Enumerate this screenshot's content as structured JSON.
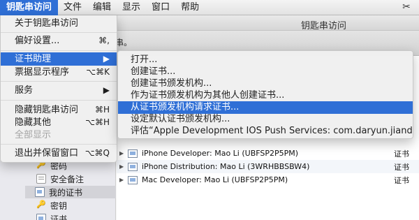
{
  "menubar": {
    "app": "钥匙串访问",
    "items": [
      "文件",
      "编辑",
      "显示",
      "窗口",
      "帮助"
    ],
    "tool_icon": "scissors-icon"
  },
  "window": {
    "title": "钥匙串访问",
    "partial_text": "串。"
  },
  "sidebar": {
    "items": [
      {
        "label": "密码",
        "icon": "key-icon"
      },
      {
        "label": "安全备注",
        "icon": "note-icon"
      },
      {
        "label": "我的证书",
        "icon": "certificate-icon"
      },
      {
        "label": "密钥",
        "icon": "key-icon"
      },
      {
        "label": "证书",
        "icon": "certificate-icon"
      }
    ]
  },
  "certlist": {
    "rows": [
      {
        "name": "iPhone Developer: Mao Li (UBFSP2P5PM)",
        "type": "证书"
      },
      {
        "name": "iPhone Distribution: Mao Li (3WRHBBSBW4)",
        "type": "证书"
      },
      {
        "name": "Mac Developer: Mao Li (UBFSP2P5PM)",
        "type": "证书"
      }
    ]
  },
  "app_menu": {
    "about": "关于钥匙串访问",
    "prefs": "偏好设置...",
    "prefs_shortcut": "⌘,",
    "cert_assistant": "证书助理",
    "ticket_viewer": "票据显示程序",
    "ticket_viewer_shortcut": "⌥⌘K",
    "services": "服务",
    "hide": "隐藏钥匙串访问",
    "hide_shortcut": "⌘H",
    "hide_others": "隐藏其他",
    "hide_others_shortcut": "⌥⌘H",
    "show_all": "全部显示",
    "quit": "退出并保留窗口",
    "quit_shortcut": "⌥⌘Q"
  },
  "submenu": {
    "items": [
      "打开...",
      "创建证书...",
      "创建证书颁发机构...",
      "作为证书颁发机构为其他人创建证书...",
      "从证书颁发机构请求证书...",
      "设定默认证书颁发机构...",
      "评估“Apple Development IOS Push Services: com.daryun.jiandao”..."
    ],
    "highlighted_index": 4
  },
  "colors": {
    "accent": "#2f6fd6"
  }
}
